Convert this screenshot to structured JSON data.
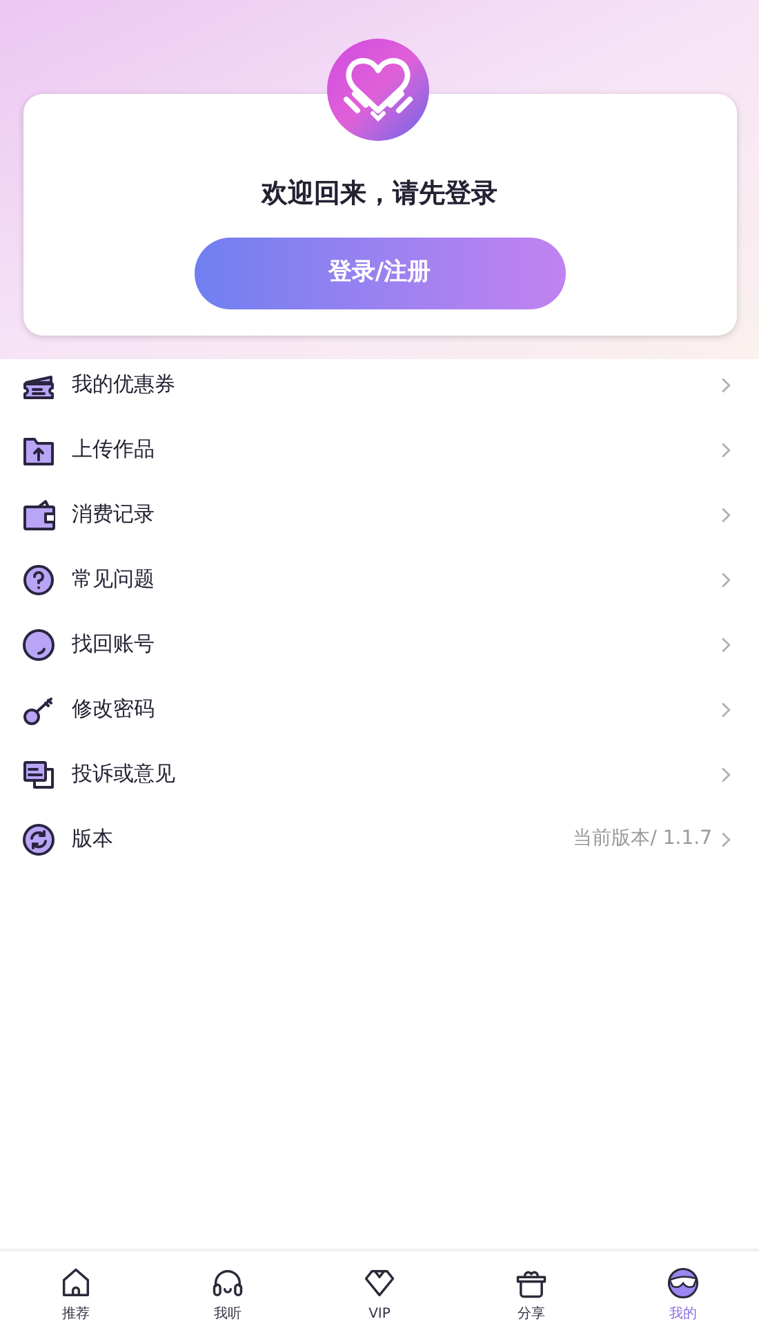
{
  "welcome": "欢迎回来，请先登录",
  "login_button": "登录/注册",
  "menu": [
    {
      "label": "我的优惠券"
    },
    {
      "label": "上传作品"
    },
    {
      "label": "消费记录"
    },
    {
      "label": "常见问题"
    },
    {
      "label": "找回账号"
    },
    {
      "label": "修改密码"
    },
    {
      "label": "投诉或意见"
    },
    {
      "label": "版本",
      "value": "当前版本/ 1.1.7"
    }
  ],
  "tabs": [
    {
      "label": "推荐",
      "selected": false
    },
    {
      "label": "我听",
      "selected": false
    },
    {
      "label": "VIP",
      "selected": false
    },
    {
      "label": "分享",
      "selected": false
    },
    {
      "label": "我的",
      "selected": true
    }
  ]
}
